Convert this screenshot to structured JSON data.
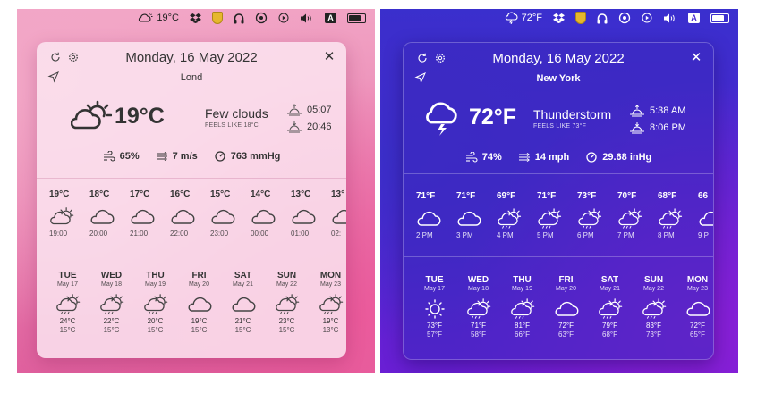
{
  "colors": {
    "light_accent": "#e980b0",
    "dark_accent": "#4d26cf",
    "sun_icon": "#f1b81e"
  },
  "light": {
    "menubar": {
      "weather_temp": "19°C",
      "input_label": "A"
    },
    "popover": {
      "date": "Monday, 16 May 2022",
      "location_input_value": "Lond",
      "temperature": "19°C",
      "condition": "Few clouds",
      "feels_like": "FEELS LIKE 18°C",
      "sunrise": "05:07",
      "sunset": "20:46",
      "humidity": "65%",
      "wind": "7 m/s",
      "pressure": "763 mmHg",
      "hourly": [
        {
          "temp": "19°C",
          "time": "19:00",
          "icon": "sun-cloud-icon"
        },
        {
          "temp": "18°C",
          "time": "20:00",
          "icon": "cloud-icon"
        },
        {
          "temp": "17°C",
          "time": "21:00",
          "icon": "cloud-icon"
        },
        {
          "temp": "16°C",
          "time": "22:00",
          "icon": "cloud-icon"
        },
        {
          "temp": "15°C",
          "time": "23:00",
          "icon": "cloud-icon"
        },
        {
          "temp": "14°C",
          "time": "00:00",
          "icon": "cloud-icon"
        },
        {
          "temp": "13°C",
          "time": "01:00",
          "icon": "cloud-icon"
        },
        {
          "temp": "13°",
          "time": "02:",
          "icon": "cloud-icon"
        }
      ],
      "daily": [
        {
          "day": "TUE",
          "date": "May 17",
          "high": "24°C",
          "low": "15°C",
          "icon": "sun-cloud-rain-icon"
        },
        {
          "day": "WED",
          "date": "May 18",
          "high": "22°C",
          "low": "15°C",
          "icon": "sun-cloud-rain-icon"
        },
        {
          "day": "THU",
          "date": "May 19",
          "high": "20°C",
          "low": "15°C",
          "icon": "sun-cloud-rain-icon"
        },
        {
          "day": "FRI",
          "date": "May 20",
          "high": "19°C",
          "low": "15°C",
          "icon": "cloud-icon"
        },
        {
          "day": "SAT",
          "date": "May 21",
          "high": "21°C",
          "low": "15°C",
          "icon": "cloud-icon"
        },
        {
          "day": "SUN",
          "date": "May 22",
          "high": "23°C",
          "low": "15°C",
          "icon": "sun-cloud-rain-icon"
        },
        {
          "day": "MON",
          "date": "May 23",
          "high": "19°C",
          "low": "13°C",
          "icon": "sun-cloud-rain-icon"
        }
      ]
    }
  },
  "dark": {
    "menubar": {
      "weather_temp": "72°F",
      "input_label": "A"
    },
    "popover": {
      "date": "Monday, 16 May 2022",
      "city": "New York",
      "temperature": "72°F",
      "condition": "Thunderstorm",
      "feels_like": "FEELS LIKE 73°F",
      "sunrise": "5:38 AM",
      "sunset": "8:06 PM",
      "humidity": "74%",
      "wind": "14 mph",
      "pressure": "29.68 inHg",
      "hourly": [
        {
          "temp": "71°F",
          "time": "2 PM",
          "icon": "cloud-icon"
        },
        {
          "temp": "71°F",
          "time": "3 PM",
          "icon": "cloud-icon"
        },
        {
          "temp": "69°F",
          "time": "4 PM",
          "icon": "sun-cloud-rain-icon"
        },
        {
          "temp": "71°F",
          "time": "5 PM",
          "icon": "sun-cloud-rain-icon"
        },
        {
          "temp": "73°F",
          "time": "6 PM",
          "icon": "sun-cloud-rain-icon"
        },
        {
          "temp": "70°F",
          "time": "7 PM",
          "icon": "sun-cloud-rain-icon"
        },
        {
          "temp": "68°F",
          "time": "8 PM",
          "icon": "sun-cloud-rain-icon"
        },
        {
          "temp": "66",
          "time": "9 P",
          "icon": "cloud-icon"
        }
      ],
      "daily": [
        {
          "day": "TUE",
          "date": "May 17",
          "high": "73°F",
          "low": "57°F",
          "icon": "sun-icon"
        },
        {
          "day": "WED",
          "date": "May 18",
          "high": "71°F",
          "low": "58°F",
          "icon": "sun-cloud-rain-icon"
        },
        {
          "day": "THU",
          "date": "May 19",
          "high": "81°F",
          "low": "66°F",
          "icon": "sun-cloud-rain-icon"
        },
        {
          "day": "FRI",
          "date": "May 20",
          "high": "72°F",
          "low": "63°F",
          "icon": "cloud-icon"
        },
        {
          "day": "SAT",
          "date": "May 21",
          "high": "79°F",
          "low": "68°F",
          "icon": "sun-cloud-rain-icon"
        },
        {
          "day": "SUN",
          "date": "May 22",
          "high": "83°F",
          "low": "73°F",
          "icon": "sun-cloud-rain-icon"
        },
        {
          "day": "MON",
          "date": "May 23",
          "high": "72°F",
          "low": "65°F",
          "icon": "cloud-icon"
        }
      ]
    }
  }
}
